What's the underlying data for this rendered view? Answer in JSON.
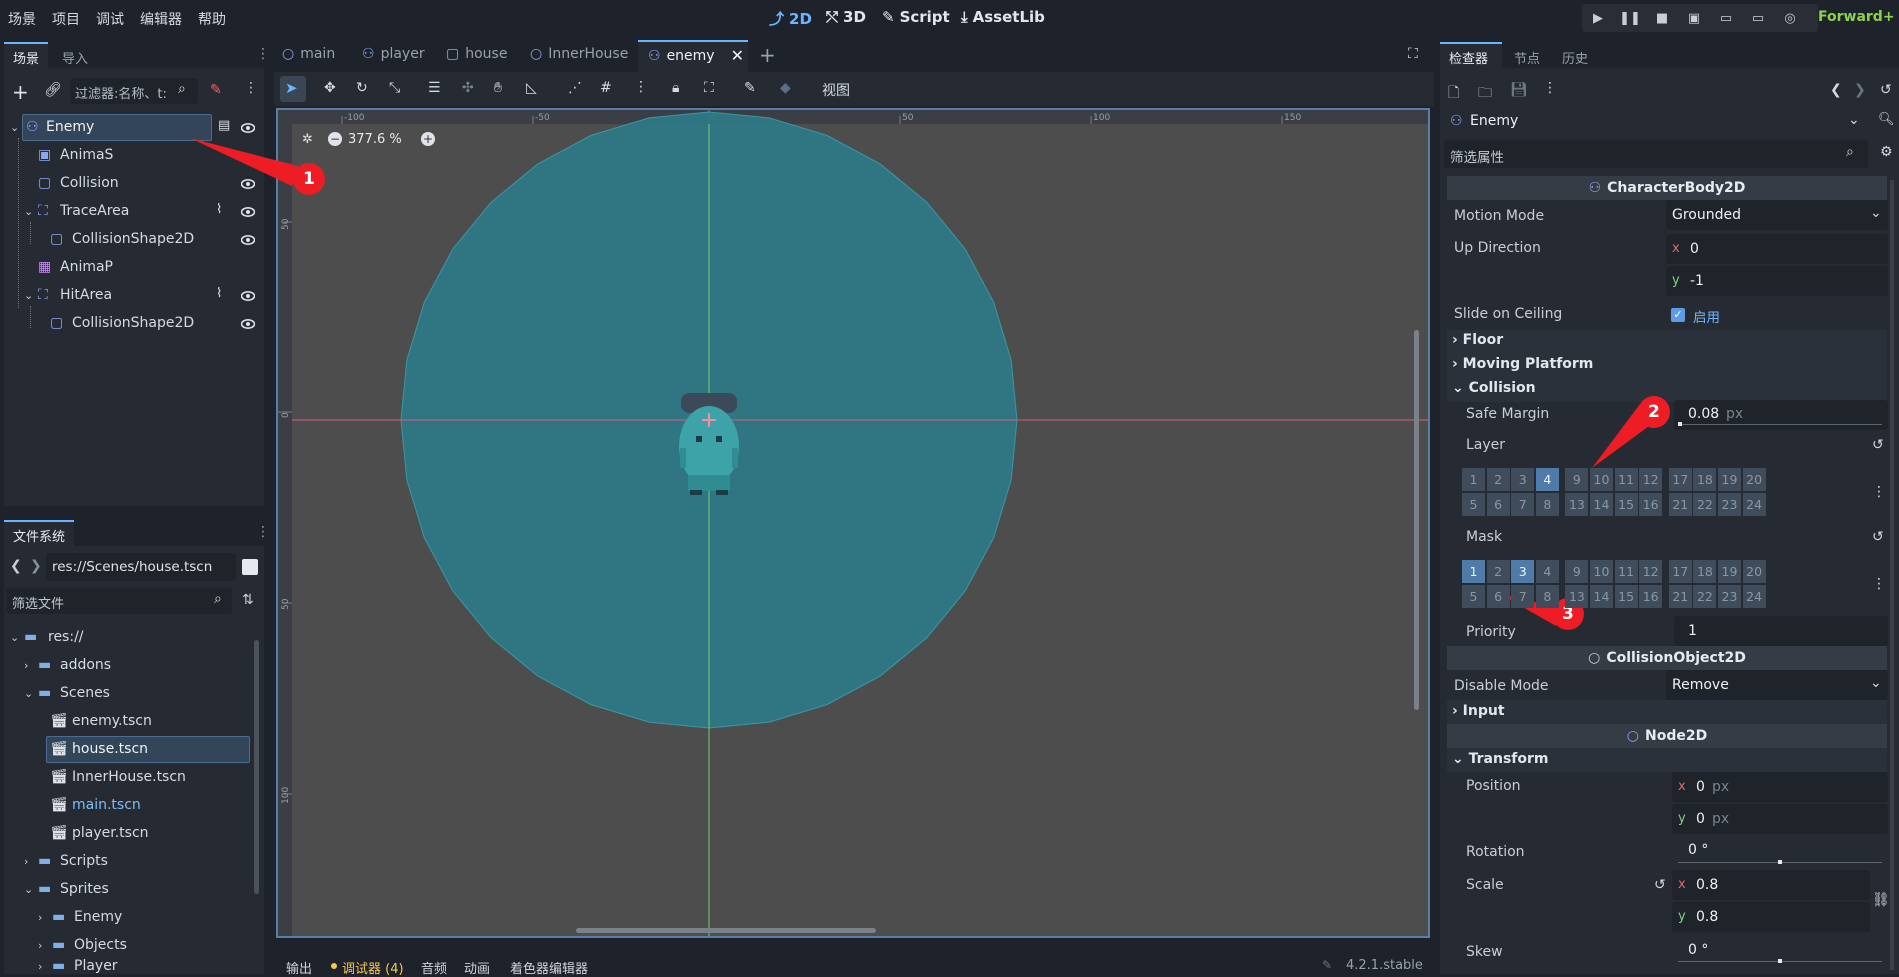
{
  "menubar": {
    "items": [
      "场景",
      "项目",
      "调试",
      "编辑器",
      "帮助"
    ]
  },
  "workspaces": {
    "items": [
      "2D",
      "3D",
      "Script",
      "AssetLib"
    ]
  },
  "renderer": "Forward+",
  "scene_dock": {
    "tabs": [
      "场景",
      "导入"
    ],
    "filter_placeholder": "过滤器:名称、t:",
    "nodes": [
      {
        "name": "Enemy",
        "icon": "characterbody-icon"
      },
      {
        "name": "AnimaS",
        "icon": "animsprite-icon"
      },
      {
        "name": "Collision",
        "icon": "collisionshape-icon"
      },
      {
        "name": "TraceArea",
        "icon": "area-icon"
      },
      {
        "name": "CollisionShape2D",
        "icon": "collisionshape-icon"
      },
      {
        "name": "AnimaP",
        "icon": "animplayer-icon"
      },
      {
        "name": "HitArea",
        "icon": "area-icon"
      },
      {
        "name": "CollisionShape2D",
        "icon": "collisionshape-icon"
      }
    ]
  },
  "filesystem_dock": {
    "title": "文件系统",
    "path": "res://Scenes/house.tscn",
    "filter_placeholder": "筛选文件",
    "items": [
      "res://",
      "addons",
      "Scenes",
      "enemy.tscn",
      "house.tscn",
      "InnerHouse.tscn",
      "main.tscn",
      "player.tscn",
      "Scripts",
      "Sprites",
      "Enemy",
      "Objects",
      "Player"
    ]
  },
  "editor_tabs": {
    "items": [
      "main",
      "player",
      "house",
      "InnerHouse",
      "enemy"
    ],
    "active": "enemy"
  },
  "viewport": {
    "zoom": "377.6 %",
    "view_menu": "视图",
    "ruler_top": [
      "-100",
      "-50",
      "0",
      "50",
      "100",
      "150"
    ],
    "ruler_left": [
      "50",
      "0",
      "50",
      "100"
    ]
  },
  "bottom_panel": {
    "tabs": [
      "输出",
      "调试器 (4)",
      "音频",
      "动画",
      "着色器编辑器"
    ],
    "version": "4.2.1.stable"
  },
  "inspector": {
    "tabs": [
      "检查器",
      "节点",
      "历史"
    ],
    "node_name": "Enemy",
    "filter_placeholder": "筛选属性",
    "class_header": "CharacterBody2D",
    "motion_mode_label": "Motion Mode",
    "motion_mode": "Grounded",
    "up_direction_label": "Up Direction",
    "up_x": "0",
    "up_y": "-1",
    "slide_on_ceiling_label": "Slide on Ceiling",
    "slide_on_ceiling": "启用",
    "groups": [
      "Floor",
      "Moving Platform",
      "Collision"
    ],
    "safe_margin_label": "Safe Margin",
    "safe_margin": "0.08",
    "unit_px": "px",
    "layer_label": "Layer",
    "mask_label": "Mask",
    "layer_on": [
      4
    ],
    "mask_on": [
      1,
      3
    ],
    "priority_label": "Priority",
    "priority": "1",
    "collision_object_header": "CollisionObject2D",
    "disable_mode_label": "Disable Mode",
    "disable_mode": "Remove",
    "input_group": "Input",
    "node2d_header": "Node2D",
    "transform_group": "Transform",
    "position_label": "Position",
    "pos_x": "0",
    "pos_y": "0",
    "rotation_label": "Rotation",
    "rotation": "0 °",
    "scale_label": "Scale",
    "scale_x": "0.8",
    "scale_y": "0.8",
    "skew_label": "Skew",
    "skew": "0 °"
  },
  "annotations": [
    "1",
    "2",
    "3"
  ],
  "colors": {
    "accent": "#6db6ff",
    "callout": "#ee1c24",
    "circle": "#2e7a87",
    "panel": "#262b33",
    "viewport": "#4d4d4d"
  }
}
